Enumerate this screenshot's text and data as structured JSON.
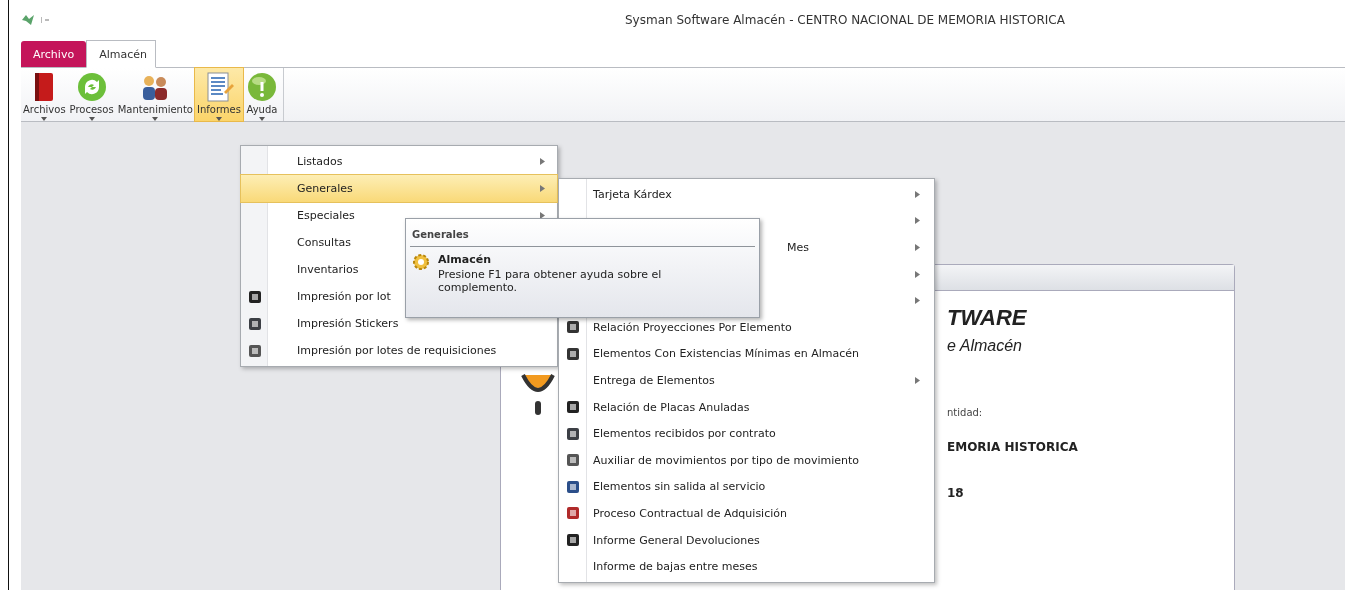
{
  "window": {
    "title": "Sysman Software Almacén - CENTRO NACIONAL DE MEMORIA HISTORICA"
  },
  "tabs": [
    {
      "label": "Archivo",
      "kind": "file",
      "selected": false
    },
    {
      "label": "Almacén",
      "kind": "tab",
      "selected": true
    }
  ],
  "ribbon": [
    {
      "label": "Archivos",
      "kind": "book",
      "selected": false
    },
    {
      "label": "Procesos",
      "kind": "cycle",
      "selected": false
    },
    {
      "label": "Mantenimiento",
      "kind": "people",
      "selected": false
    },
    {
      "label": "Informes",
      "kind": "report",
      "selected": true
    },
    {
      "label": "Ayuda",
      "kind": "help",
      "selected": false
    }
  ],
  "menu": [
    {
      "label": "Listados",
      "submenu": true,
      "icon": false,
      "selected": false
    },
    {
      "label": "Generales",
      "submenu": true,
      "icon": false,
      "selected": true
    },
    {
      "label": "Especiales",
      "submenu": true,
      "icon": false,
      "selected": false
    },
    {
      "label": "Consultas",
      "icon": false,
      "selected": false
    },
    {
      "label": "Inventarios",
      "icon": false,
      "selected": false
    },
    {
      "label": "Impresión por lot",
      "submenu": false,
      "icon": true,
      "selected": false
    },
    {
      "label": "Impresión Stickers",
      "submenu": false,
      "icon": true,
      "selected": false
    },
    {
      "label": "Impresión por lotes de requisiciones",
      "submenu": false,
      "icon": true,
      "selected": false
    }
  ],
  "submenu": [
    {
      "kind": "plain",
      "label": "Tarjeta Kárdex",
      "submenu": true,
      "icon": false
    },
    {
      "kind": "covered",
      "submenu": true,
      "icon": false
    },
    {
      "kind": "covered",
      "label": "Mes",
      "submenu": true,
      "icon": false
    },
    {
      "kind": "covered",
      "submenu": true,
      "icon": false
    },
    {
      "kind": "covered",
      "submenu": true,
      "icon": false
    },
    {
      "kind": "plain",
      "label": "Relación Proyecciones Por Elemento",
      "submenu": false,
      "icon": true
    },
    {
      "kind": "plain",
      "label": "Elementos Con Existencias Mínimas en Almacén",
      "submenu": false,
      "icon": true
    },
    {
      "kind": "plain",
      "label": "Entrega de Elementos",
      "submenu": true,
      "icon": false
    },
    {
      "kind": "plain",
      "label": "Relación de Placas Anuladas",
      "submenu": false,
      "icon": true
    },
    {
      "kind": "plain",
      "label": "Elementos recibidos por contrato",
      "submenu": false,
      "icon": true
    },
    {
      "kind": "plain",
      "label": "Auxiliar de movimientos por tipo de movimiento",
      "submenu": false,
      "icon": true
    },
    {
      "kind": "plain",
      "label": "Elementos sin salida al servicio",
      "submenu": false,
      "icon": true
    },
    {
      "kind": "plain",
      "label": "Proceso Contractual de Adquisición",
      "submenu": false,
      "icon": true
    },
    {
      "kind": "plain",
      "label": "Informe General Devoluciones",
      "submenu": false,
      "icon": true
    },
    {
      "kind": "plain",
      "label": "Informe de bajas entre meses",
      "submenu": false,
      "icon": false
    }
  ],
  "tooltip": {
    "title": "Generales",
    "item": "Almacén",
    "text": "Presione F1 para obtener ayuda sobre el complemento."
  },
  "card": {
    "heading": "TWARE",
    "subheading": "e Almacén",
    "label": "ntidad:",
    "entity": "EMORIA HISTORICA",
    "year": "18"
  }
}
